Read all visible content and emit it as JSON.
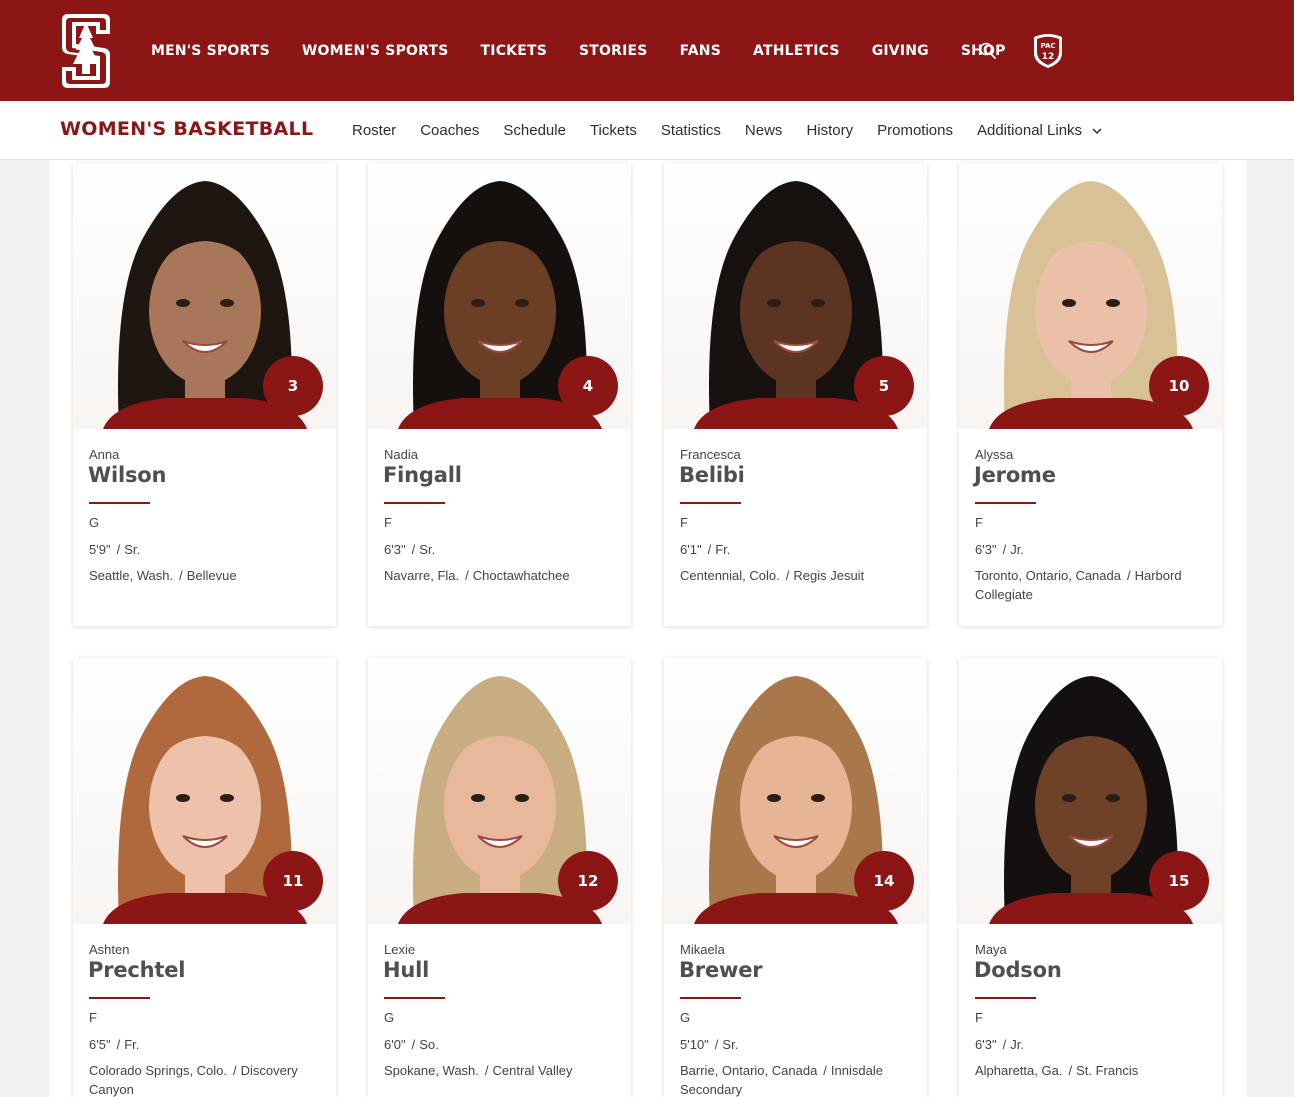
{
  "header": {
    "nav": [
      "MEN'S SPORTS",
      "WOMEN'S SPORTS",
      "TICKETS",
      "STORIES",
      "FANS",
      "ATHLETICS",
      "GIVING",
      "SHOP"
    ],
    "brand_color": "#8c1515",
    "icons": [
      "stanford-s-logo",
      "search-icon",
      "pac12-logo"
    ]
  },
  "subnav": {
    "sport": "WOMEN'S BASKETBALL",
    "items": [
      "Roster",
      "Coaches",
      "Schedule",
      "Tickets",
      "Statistics",
      "News",
      "History",
      "Promotions",
      "Additional Links"
    ]
  },
  "roster": [
    {
      "number": "3",
      "first": "Anna",
      "last": "Wilson",
      "position": "G",
      "height": "5'9\"",
      "year": "Sr.",
      "hometown": "Seattle, Wash.",
      "school": "Bellevue",
      "hair": "#1f1612",
      "skin": "#a8775a"
    },
    {
      "number": "4",
      "first": "Nadia",
      "last": "Fingall",
      "position": "F",
      "height": "6'3\"",
      "year": "Sr.",
      "hometown": "Navarre, Fla.",
      "school": "Choctawhatchee",
      "hair": "#15100d",
      "skin": "#6b3f26"
    },
    {
      "number": "5",
      "first": "Francesca",
      "last": "Belibi",
      "position": "F",
      "height": "6'1\"",
      "year": "Fr.",
      "hometown": "Centennial, Colo.",
      "school": "Regis Jesuit",
      "hair": "#171210",
      "skin": "#5b3422"
    },
    {
      "number": "10",
      "first": "Alyssa",
      "last": "Jerome",
      "position": "F",
      "height": "6'3\"",
      "year": "Jr.",
      "hometown": "Toronto, Ontario, Canada",
      "school": "Harbord Collegiate",
      "hair": "#d8c197",
      "skin": "#eac1a8"
    },
    {
      "number": "11",
      "first": "Ashten",
      "last": "Prechtel",
      "position": "F",
      "height": "6'5\"",
      "year": "Fr.",
      "hometown": "Colorado Springs, Colo.",
      "school": "Discovery Canyon",
      "hair": "#b0683d",
      "skin": "#eec2aa"
    },
    {
      "number": "12",
      "first": "Lexie",
      "last": "Hull",
      "position": "G",
      "height": "6'0\"",
      "year": "So.",
      "hometown": "Spokane, Wash.",
      "school": "Central Valley",
      "hair": "#c8ad82",
      "skin": "#e8b89c"
    },
    {
      "number": "14",
      "first": "Mikaela",
      "last": "Brewer",
      "position": "G",
      "height": "5'10\"",
      "year": "Sr.",
      "hometown": "Barrie, Ontario, Canada",
      "school": "Innisdale Secondary",
      "hair": "#a8774a",
      "skin": "#e6b596"
    },
    {
      "number": "15",
      "first": "Maya",
      "last": "Dodson",
      "position": "F",
      "height": "6'3\"",
      "year": "Jr.",
      "hometown": "Alpharetta, Ga.",
      "school": "St. Francis",
      "hair": "#141010",
      "skin": "#6e4129"
    }
  ]
}
